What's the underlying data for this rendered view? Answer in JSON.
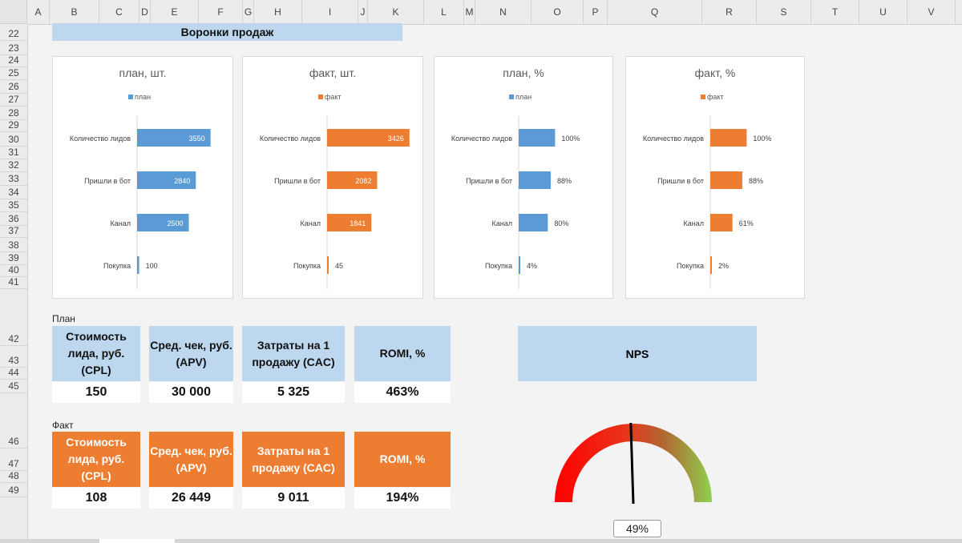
{
  "columns": [
    {
      "label": "A",
      "w": 28
    },
    {
      "label": "B",
      "w": 62
    },
    {
      "label": "C",
      "w": 50
    },
    {
      "label": "D",
      "w": 14
    },
    {
      "label": "E",
      "w": 60
    },
    {
      "label": "F",
      "w": 55
    },
    {
      "label": "G",
      "w": 14
    },
    {
      "label": "H",
      "w": 60
    },
    {
      "label": "I",
      "w": 70
    },
    {
      "label": "J",
      "w": 12
    },
    {
      "label": "K",
      "w": 70
    },
    {
      "label": "L",
      "w": 50
    },
    {
      "label": "M",
      "w": 14
    },
    {
      "label": "N",
      "w": 70
    },
    {
      "label": "O",
      "w": 65
    },
    {
      "label": "P",
      "w": 30
    },
    {
      "label": "Q",
      "w": 118
    },
    {
      "label": "R",
      "w": 68
    },
    {
      "label": "S",
      "w": 68
    },
    {
      "label": "T",
      "w": 60
    },
    {
      "label": "U",
      "w": 60
    },
    {
      "label": "V",
      "w": 60
    }
  ],
  "rows": [
    {
      "n": "22",
      "h": 21
    },
    {
      "n": "23",
      "h": 18
    },
    {
      "n": "24",
      "h": 15
    },
    {
      "n": "25",
      "h": 16
    },
    {
      "n": "26",
      "h": 17
    },
    {
      "n": "27",
      "h": 16
    },
    {
      "n": "28",
      "h": 17
    },
    {
      "n": "29",
      "h": 15
    },
    {
      "n": "30",
      "h": 18
    },
    {
      "n": "31",
      "h": 16
    },
    {
      "n": "32",
      "h": 16
    },
    {
      "n": "33",
      "h": 17
    },
    {
      "n": "34",
      "h": 17
    },
    {
      "n": "35",
      "h": 16
    },
    {
      "n": "36",
      "h": 17
    },
    {
      "n": "37",
      "h": 15
    },
    {
      "n": "38",
      "h": 18
    },
    {
      "n": "39",
      "h": 16
    },
    {
      "n": "40",
      "h": 15
    },
    {
      "n": "41",
      "h": 15
    },
    {
      "n": "42",
      "h": 71
    },
    {
      "n": "43",
      "h": 27
    },
    {
      "n": "44",
      "h": 15
    },
    {
      "n": "45",
      "h": 17
    },
    {
      "n": "46",
      "h": 69
    },
    {
      "n": "47",
      "h": 28
    },
    {
      "n": "48",
      "h": 15
    },
    {
      "n": "49",
      "h": 18
    }
  ],
  "banner": "Воронки продаж",
  "colors": {
    "plan": "#5b9bd5",
    "fact": "#ed7d31",
    "plan_header": "#bdd7ee",
    "fact_header": "#ed7d31"
  },
  "chart_data": [
    {
      "type": "bar",
      "title": "план, шт.",
      "legend": "план",
      "color": "#5b9bd5",
      "categories": [
        "Количество лидов",
        "Пришли в бот",
        "Канал",
        "Покупка"
      ],
      "values": [
        3550,
        2840,
        2500,
        100
      ],
      "labels": [
        "3550",
        "2840",
        "2500",
        "100"
      ],
      "xlim": [
        0,
        4300
      ],
      "labels_inside": true
    },
    {
      "type": "bar",
      "title": "факт, шт.",
      "legend": "факт",
      "color": "#ed7d31",
      "categories": [
        "Количество лидов",
        "Пришли в бот",
        "Канал",
        "Покупка"
      ],
      "values": [
        3426,
        2082,
        1841,
        45
      ],
      "labels": [
        "3426",
        "2082",
        "1841",
        "45"
      ],
      "xlim": [
        0,
        3700
      ],
      "labels_inside": true
    },
    {
      "type": "bar",
      "title": "план, %",
      "legend": "план",
      "color": "#5b9bd5",
      "categories": [
        "Количество лидов",
        "Пришли в бот",
        "Канал",
        "Покупка"
      ],
      "values": [
        100,
        88,
        80,
        4
      ],
      "labels": [
        "100%",
        "88%",
        "80%",
        "4%"
      ],
      "xlim": [
        0,
        240
      ],
      "labels_inside": false
    },
    {
      "type": "bar",
      "title": "факт, %",
      "legend": "факт",
      "color": "#ed7d31",
      "categories": [
        "Количество лидов",
        "Пришли в бот",
        "Канал",
        "Покупка"
      ],
      "values": [
        100,
        88,
        61,
        2
      ],
      "labels": [
        "100%",
        "88%",
        "61%",
        "2%"
      ],
      "xlim": [
        0,
        240
      ],
      "labels_inside": false
    }
  ],
  "plan": {
    "label": "План",
    "kpis": [
      {
        "title": "Стоимость лида, руб. (CPL)",
        "value": "150"
      },
      {
        "title": "Сред. чек, руб. (APV)",
        "value": "30 000"
      },
      {
        "title": "Затраты на 1 продажу (CAC)",
        "value": "5 325"
      },
      {
        "title": "ROMI, %",
        "value": "463%"
      }
    ]
  },
  "fact": {
    "label": "Факт",
    "kpis": [
      {
        "title": "Стоимость лида, руб. (CPL)",
        "value": "108"
      },
      {
        "title": "Сред. чек, руб. (APV)",
        "value": "26 449"
      },
      {
        "title": "Затраты на 1 продажу (CAC)",
        "value": "9 011"
      },
      {
        "title": "ROMI, %",
        "value": "194%"
      }
    ]
  },
  "nps": {
    "title": "NPS",
    "value_text": "49%",
    "value": 0.49
  }
}
